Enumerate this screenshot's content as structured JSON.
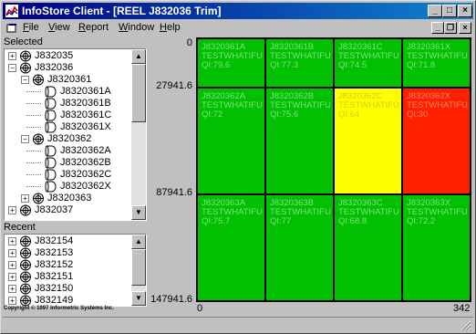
{
  "window": {
    "title": "InfoStore Client - [REEL J832036 Trim]",
    "controls": {
      "minimize": "_",
      "maximize": "□",
      "close": "×"
    },
    "mdi_controls": {
      "minimize": "_",
      "restore": "❐",
      "close": "×"
    }
  },
  "menu": [
    {
      "label": "File",
      "key": "F",
      "rest": "ile"
    },
    {
      "label": "View",
      "key": "V",
      "rest": "iew"
    },
    {
      "label": "Report",
      "key": "R",
      "rest": "eport"
    },
    {
      "label": "Window",
      "key": "W",
      "rest": "indow"
    },
    {
      "label": "Help",
      "key": "H",
      "rest": "elp"
    }
  ],
  "selected_panel": {
    "label": "Selected",
    "items": [
      {
        "text": "J832035",
        "level": 0,
        "expander": "+",
        "icon": "reel-icon"
      },
      {
        "text": "J832036",
        "level": 0,
        "expander": "−",
        "icon": "reel-icon"
      },
      {
        "text": "J8320361",
        "level": 1,
        "expander": "−",
        "icon": "reel-icon"
      },
      {
        "text": "J8320361A",
        "level": 2,
        "expander": "",
        "icon": "roll-icon"
      },
      {
        "text": "J8320361B",
        "level": 2,
        "expander": "",
        "icon": "roll-icon"
      },
      {
        "text": "J8320361C",
        "level": 2,
        "expander": "",
        "icon": "roll-icon"
      },
      {
        "text": "J8320361X",
        "level": 2,
        "expander": "",
        "icon": "roll-icon"
      },
      {
        "text": "J8320362",
        "level": 1,
        "expander": "−",
        "icon": "reel-icon"
      },
      {
        "text": "J8320362A",
        "level": 2,
        "expander": "",
        "icon": "roll-icon"
      },
      {
        "text": "J8320362B",
        "level": 2,
        "expander": "",
        "icon": "roll-icon"
      },
      {
        "text": "J8320362C",
        "level": 2,
        "expander": "",
        "icon": "roll-icon"
      },
      {
        "text": "J8320362X",
        "level": 2,
        "expander": "",
        "icon": "roll-icon"
      },
      {
        "text": "J8320363",
        "level": 1,
        "expander": "+",
        "icon": "reel-icon"
      },
      {
        "text": "J832037",
        "level": 0,
        "expander": "+",
        "icon": "reel-icon"
      }
    ]
  },
  "recent_panel": {
    "label": "Recent",
    "items": [
      {
        "text": "J832154",
        "expander": "+"
      },
      {
        "text": "J832153",
        "expander": "+"
      },
      {
        "text": "J832152",
        "expander": "+"
      },
      {
        "text": "J832151",
        "expander": "+"
      },
      {
        "text": "J832150",
        "expander": "+"
      },
      {
        "text": "J832149",
        "expander": "+"
      }
    ]
  },
  "copyright": "Copyright © 1997 Informetric Systems Inc.",
  "reel_map": {
    "y_ticks": [
      "0",
      "27941.6",
      "87941.6",
      "147941.6"
    ],
    "y_values": [
      0,
      27941.6,
      87941.6,
      147941.6
    ],
    "x_ticks": [
      "0",
      "342"
    ],
    "x_range": [
      0,
      342
    ],
    "columns": 4,
    "colors": {
      "green": "#00c000",
      "yellow": "#ffff00",
      "red": "#ff2000",
      "grid": "#000000"
    },
    "rows": [
      {
        "y_start": 0,
        "y_end": 27941.6,
        "cells": [
          {
            "name": "J8320361A",
            "test": "TESTWHATIFU",
            "qi": "QI:79.6",
            "color": "#00c000"
          },
          {
            "name": "J8320361B",
            "test": "TESTWHATIFU",
            "qi": "QI:77.3",
            "color": "#00c000"
          },
          {
            "name": "J8320361C",
            "test": "TESTWHATIFU",
            "qi": "QI:74.5",
            "color": "#00c000"
          },
          {
            "name": "J8320361X",
            "test": "TESTWHATIFU",
            "qi": "QI:71.8",
            "color": "#00c000"
          }
        ]
      },
      {
        "y_start": 27941.6,
        "y_end": 87941.6,
        "cells": [
          {
            "name": "J8320362A",
            "test": "TESTWHATIFU",
            "qi": "QI:72",
            "color": "#00c000"
          },
          {
            "name": "J8320362B",
            "test": "TESTWHATIFU",
            "qi": "QI:75.6",
            "color": "#00c000"
          },
          {
            "name": "J8320362C",
            "test": "TESTWHATIFU",
            "qi": "QI:64",
            "color": "#ffff00"
          },
          {
            "name": "J8320362X",
            "test": "TESTWHATIFU",
            "qi": "QI:30",
            "color": "#ff2000"
          }
        ]
      },
      {
        "y_start": 87941.6,
        "y_end": 147941.6,
        "cells": [
          {
            "name": "J8320363A",
            "test": "TESTWHATIFU",
            "qi": "QI:75.7",
            "color": "#00c000"
          },
          {
            "name": "J8320363B",
            "test": "TESTWHATIFU",
            "qi": "QI:77",
            "color": "#00c000"
          },
          {
            "name": "J8320363C",
            "test": "TESTWHATIFU",
            "qi": "QI:68.8",
            "color": "#00c000"
          },
          {
            "name": "J8320363X",
            "test": "TESTWHATIFU",
            "qi": "QI:72.2",
            "color": "#00c000"
          }
        ]
      }
    ]
  }
}
